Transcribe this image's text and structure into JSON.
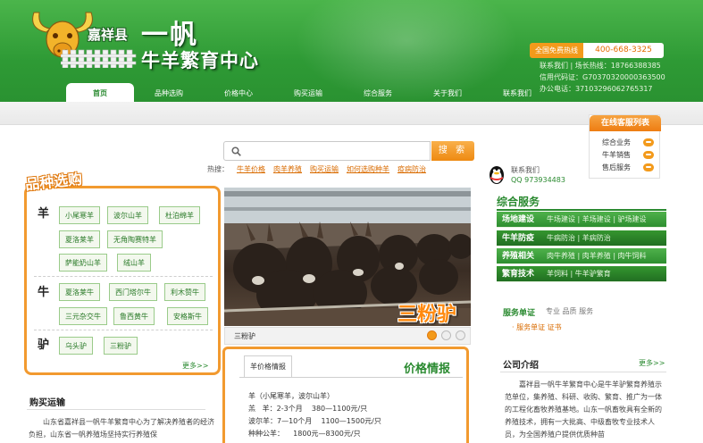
{
  "header": {
    "county": "嘉祥县",
    "brand": "一帆",
    "subtitle": "牛羊繁育中心",
    "hotline_label": "全国免费热线",
    "hotline_number": "400-668-3325",
    "contact_line1": "联系我们 | 场长热线：18766388385",
    "contact_line2": "信用代码证：G70370320000363500",
    "contact_line3": "办公电话：37103296062765317"
  },
  "nav": [
    {
      "label": "首页"
    },
    {
      "label": "品种选购"
    },
    {
      "label": "价格中心"
    },
    {
      "label": "购买运输"
    },
    {
      "label": "综合服务"
    },
    {
      "label": "关于我们"
    },
    {
      "label": "联系我们"
    }
  ],
  "search": {
    "button": "搜 索",
    "placeholder": "",
    "hot_label": "热搜：",
    "hot_words": [
      "牛羊价格",
      "肉羊养殖",
      "购买运输",
      "如何选购种羊",
      "疫病防治"
    ]
  },
  "service_panel": {
    "title": "在线客服列表",
    "items": [
      "综合业务",
      "牛羊销售",
      "售后服务"
    ]
  },
  "qq": {
    "contact": "联系我们",
    "number": "QQ 973934483"
  },
  "varieties": {
    "title": "品种选购",
    "sheep_label": "羊",
    "cattle_label": "牛",
    "donkey_label": "驴",
    "sheep": [
      "小尾寒羊",
      "波尔山羊",
      "杜泊绵羊",
      "夏洛莱羊",
      "无角陶赛特羊",
      "萨能奶山羊",
      "绒山羊"
    ],
    "cattle": [
      "夏洛莱牛",
      "西门塔尔牛",
      "利木赞牛",
      "三元杂交牛",
      "鲁西黄牛",
      "安格斯牛"
    ],
    "donkey": [
      "乌头驴",
      "三粉驴"
    ],
    "more": "更多>>"
  },
  "slideshow": {
    "watermark": "三粉驴",
    "caption": "三粉驴"
  },
  "price": {
    "tab": "羊价格情报",
    "heading": "价格情报",
    "lines": [
      "羊（小尾寒羊，波尔山羊）",
      "羔   羊：2-3个月    380—1100元/只",
      "波尔羊：7—10个月    1100—1500元/只",
      "种种公羊：    1800元—8300元/只"
    ]
  },
  "purchase": {
    "title": "购买运输",
    "text": "山东省嘉祥县一帆牛羊繁育中心为了解决养殖者的经济负担，山东省一帆养殖场坚持实行养殖保"
  },
  "services": {
    "title": "综合服务",
    "rows": [
      {
        "title": "场地建设",
        "links": "牛场建设 | 羊场建设 | 驴场建设"
      },
      {
        "title": "牛羊防疫",
        "links": "牛病防治 | 羊病防治"
      },
      {
        "title": "养殖相关",
        "links": "肉牛养殖 | 肉羊养殖 | 肉牛饲料"
      },
      {
        "title": "繁育技术",
        "links": "羊饲料 | 牛羊驴繁育"
      }
    ]
  },
  "news": {
    "label": "服务单证",
    "sub": "专业 品质 服务",
    "links": "· 服务单证    证书"
  },
  "about": {
    "title": "公司介绍",
    "more": "更多>>",
    "text": "嘉祥县一帆牛羊繁育中心是牛羊驴繁育养殖示范单位，集养殖、科研、收购、繁育、推广为一体的工程化畜牧养殖基地。山东一帆畜牧具有全新的养殖技术，拥有一大批高、中级畜牧专业技术人员，为全国养殖户提供优质种苗"
  }
}
